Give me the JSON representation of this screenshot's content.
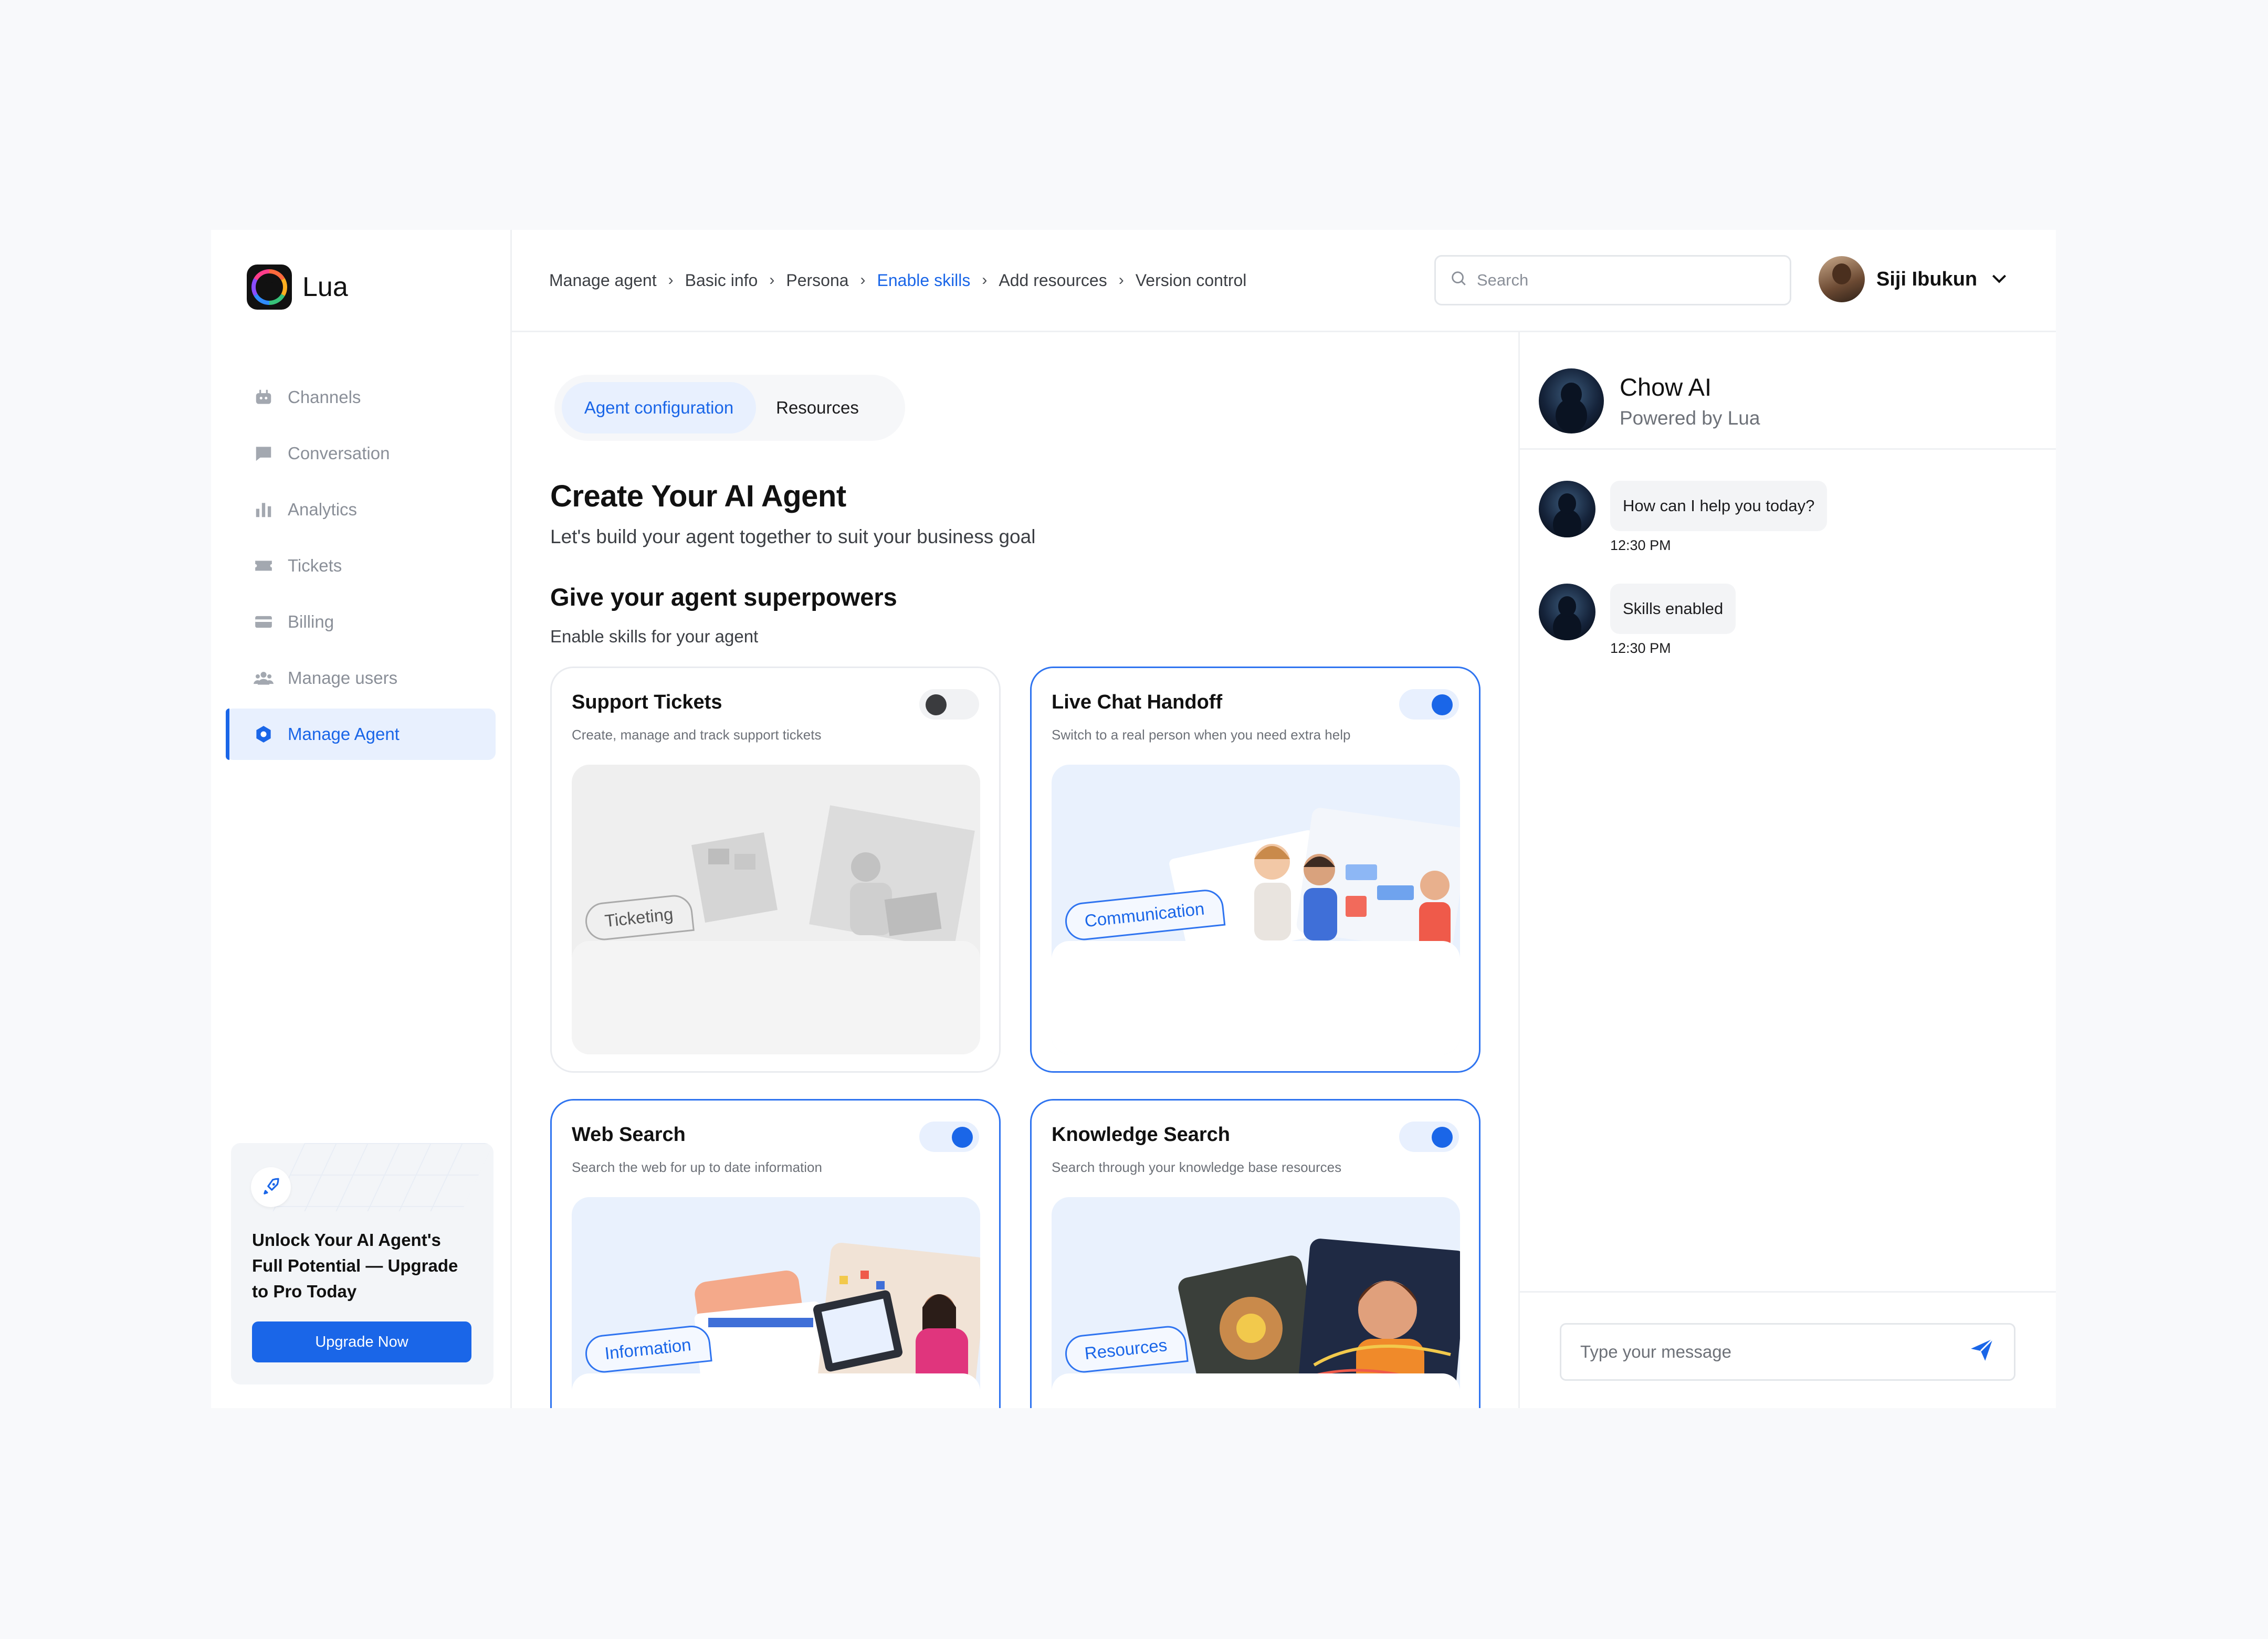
{
  "app": {
    "name": "Lua"
  },
  "sidebar": {
    "items": [
      {
        "label": "Channels",
        "icon": "bot-icon"
      },
      {
        "label": "Conversation",
        "icon": "chat-bubble-icon"
      },
      {
        "label": "Analytics",
        "icon": "bar-chart-icon"
      },
      {
        "label": "Tickets",
        "icon": "ticket-icon"
      },
      {
        "label": "Billing",
        "icon": "card-icon"
      },
      {
        "label": "Manage users",
        "icon": "users-icon"
      },
      {
        "label": "Manage Agent",
        "icon": "gear-icon",
        "active": true
      }
    ],
    "promo": {
      "title": "Unlock Your AI Agent's Full Potential — Upgrade to Pro Today",
      "button": "Upgrade Now"
    }
  },
  "header": {
    "breadcrumbs": [
      "Manage agent",
      "Basic info",
      "Persona",
      "Enable skills",
      "Add resources",
      "Version control"
    ],
    "current_crumb": "Enable skills",
    "search_placeholder": "Search",
    "user_name": "Siji Ibukun"
  },
  "main": {
    "tabs": [
      "Agent configuration",
      "Resources"
    ],
    "active_tab": "Agent configuration",
    "title": "Create Your AI Agent",
    "subtitle": "Let's build your agent together to suit your business goal",
    "section_title": "Give your agent superpowers",
    "section_subtitle": "Enable skills for your agent",
    "skills": [
      {
        "title": "Support Tickets",
        "desc": "Create, manage and track support tickets",
        "tag": "Ticketing",
        "enabled": false
      },
      {
        "title": "Live Chat Handoff",
        "desc": "Switch to a real person when you need extra help",
        "tag": "Communication",
        "enabled": true
      },
      {
        "title": "Web Search",
        "desc": "Search the web for up to date information",
        "tag": "Information",
        "enabled": true
      },
      {
        "title": "Knowledge Search",
        "desc": "Search through your knowledge base resources",
        "tag": "Resources",
        "enabled": true
      }
    ]
  },
  "chat": {
    "name": "Chow AI",
    "powered_by": "Powered by Lua",
    "messages": [
      {
        "text": "How can I help you today?",
        "time": "12:30 PM"
      },
      {
        "text": "Skills enabled",
        "time": "12:30 PM"
      }
    ],
    "input_placeholder": "Type your message"
  },
  "colors": {
    "accent": "#1a66e8",
    "accent_soft": "#e8f0fe",
    "border": "#eef0f3"
  }
}
